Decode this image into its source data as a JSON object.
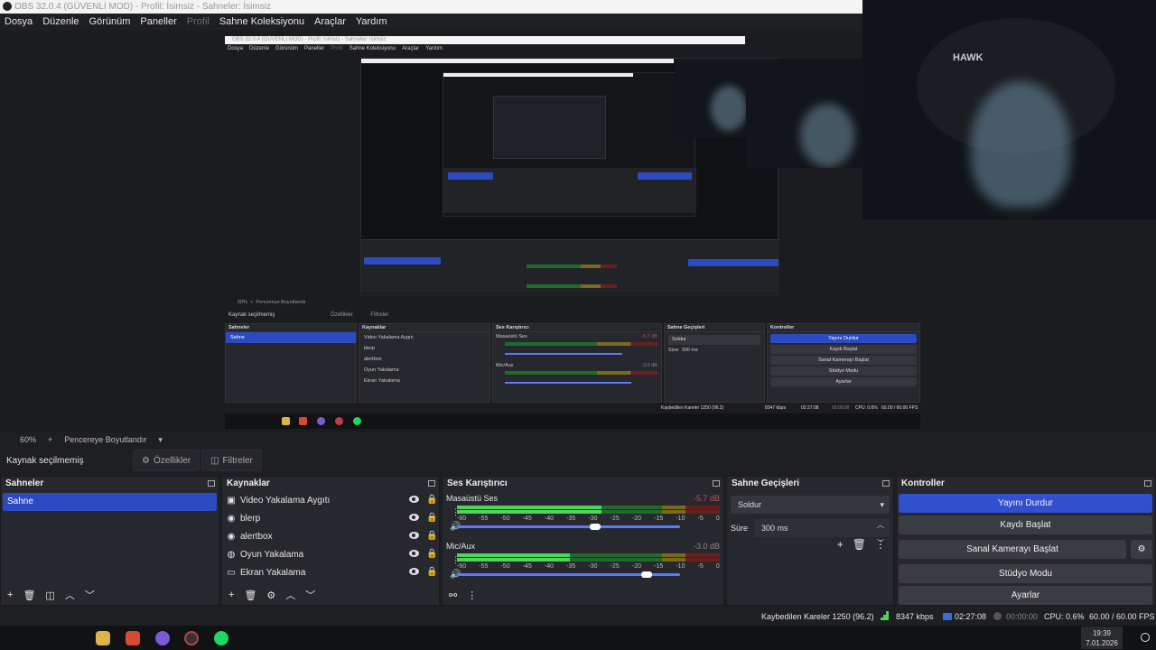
{
  "window": {
    "title": "OBS 32.0.4 (GÜVENLİ MOD) - Profil: İsimsiz - Sahneler: İsimsiz"
  },
  "menu": [
    "Dosya",
    "Düzenle",
    "Görünüm",
    "Paneller",
    "Profil",
    "Sahne Koleksiyonu",
    "Araçlar",
    "Yardım"
  ],
  "inner": {
    "title": "OBS 32.0.4 (GÜVENLİ MOD) - Profil: İsimsiz - Sahneler: İsimsiz",
    "menu": [
      "Dosya",
      "Düzenle",
      "Görünüm",
      "Paneller",
      "Profil",
      "Sahne Koleksiyonu",
      "Araçlar",
      "Yardım"
    ],
    "toolbar": {
      "zoom": "60%",
      "fit": "Pencereye Boyutlandır"
    },
    "no_source": "Kaynak seçilmemiş",
    "props": "Özellikler",
    "filters": "Filtreler",
    "scenes_title": "Sahneler",
    "scene": "Sahne",
    "sources_title": "Kaynaklar",
    "sources": [
      "Video Yakalama Aygıtı",
      "blerp",
      "alertbox",
      "Oyun Yakalama",
      "Ekran Yakalama"
    ],
    "mixer_title": "Ses Karıştırıcı",
    "desktop": "Masaüstü Ses",
    "desktop_db": "-5.7 dB",
    "mic": "Mic/Aux",
    "mic_db": "-3.0 dB",
    "trans_title": "Sahne Geçişleri",
    "trans": "Soldur",
    "dur_label": "Süre",
    "dur": "300 ms",
    "ctl_title": "Kontroller",
    "ctl": [
      "Yayını Durdur",
      "Kaydı Başlat",
      "Sanal Kamerayı Başlat",
      "Stüdyo Modu",
      "Ayarlar"
    ],
    "status": {
      "dropped": "Kaybedilen Kareler 1250 (96.2)",
      "kbps": "8347 kbps",
      "live": "02:27:08",
      "rec": "00:00:00",
      "cpu": "CPU: 0.6%",
      "fps": "60.00 / 60.00 FPS"
    }
  },
  "toolbar": {
    "zoom": "60%",
    "plus": "+",
    "fit": "Pencereye Boyutlandır"
  },
  "source_bar": {
    "no_source": "Kaynak seçilmemiş",
    "properties": "Özellikler",
    "filters": "Filtreler"
  },
  "scenes": {
    "title": "Sahneler",
    "items": [
      "Sahne"
    ]
  },
  "sources": {
    "title": "Kaynaklar",
    "items": [
      {
        "label": "Video Yakalama Aygıtı",
        "icon": "camera-icon"
      },
      {
        "label": "blerp",
        "icon": "globe-icon"
      },
      {
        "label": "alertbox",
        "icon": "globe-icon"
      },
      {
        "label": "Oyun Yakalama",
        "icon": "gamepad-icon"
      },
      {
        "label": "Ekran Yakalama",
        "icon": "monitor-icon"
      }
    ]
  },
  "mixer": {
    "title": "Ses Karıştırıcı",
    "channels": [
      {
        "name": "Masaüstü Ses",
        "db": "-5.7 dB",
        "level": 0.62
      },
      {
        "name": "Mic/Aux",
        "db": "-3.0 dB",
        "level": 0.85
      }
    ],
    "ticks": [
      "-60",
      "-55",
      "-50",
      "-45",
      "-40",
      "-35",
      "-30",
      "-25",
      "-20",
      "-15",
      "-10",
      "-5",
      "0"
    ]
  },
  "transitions": {
    "title": "Sahne Geçişleri",
    "selected": "Soldur",
    "duration_label": "Süre",
    "duration": "300 ms"
  },
  "controls": {
    "title": "Kontroller",
    "buttons": [
      "Yayını Durdur",
      "Kaydı Başlat",
      "Sanal Kamerayı Başlat",
      "Stüdyo Modu",
      "Ayarlar"
    ]
  },
  "status": {
    "dropped": "Kaybedilen Kareler 1250 (96.2)",
    "kbps": "8347 kbps",
    "live_time": "02:27:08",
    "rec_time": "00:00:00",
    "cpu": "CPU: 0.6%",
    "fps": "60.00 / 60.00 FPS"
  },
  "webcam": {
    "logo": "HAWK"
  },
  "taskbar": {
    "time": "19:39",
    "date": "7.01.2026"
  },
  "colors": {
    "accent": "#3050d0",
    "panel": "#27282d",
    "bg": "#1e1f22"
  }
}
